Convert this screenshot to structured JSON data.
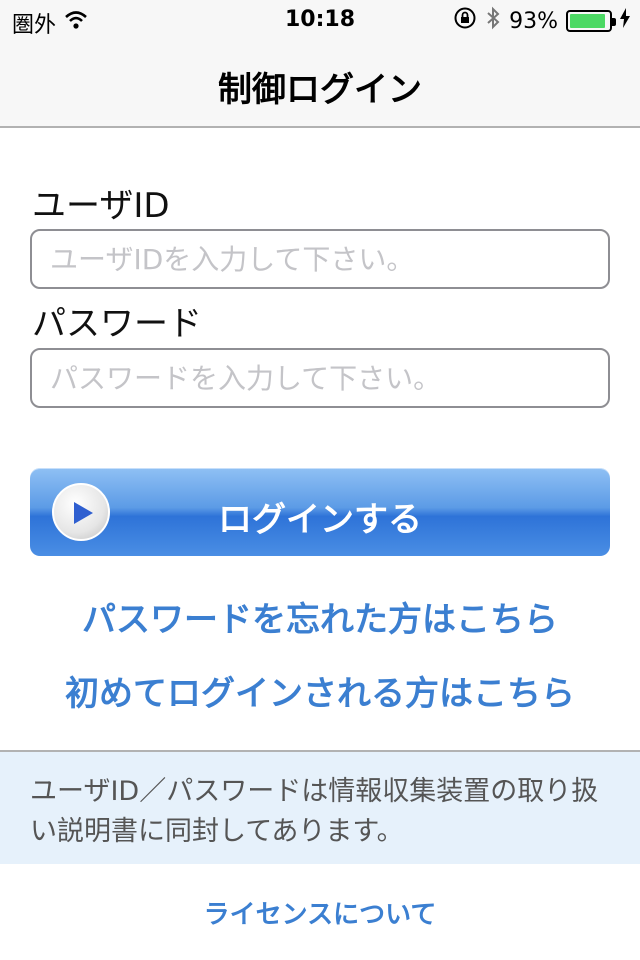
{
  "status_bar": {
    "carrier": "圏外",
    "time": "10:18",
    "battery_percent": "93%",
    "battery_level": 0.93,
    "icons": [
      "wifi-icon",
      "rotation-lock-icon",
      "bluetooth-icon",
      "battery-icon",
      "charging-bolt-icon"
    ]
  },
  "nav": {
    "title": "制御ログイン"
  },
  "form": {
    "user_id_label": "ユーザID",
    "user_id_placeholder": "ユーザIDを入力して下さい。",
    "user_id_value": "",
    "password_label": "パスワード",
    "password_placeholder": "パスワードを入力して下さい。",
    "password_value": "",
    "login_button": "ログインする",
    "login_button_icon": "play-icon"
  },
  "links": {
    "forgot_password": "パスワードを忘れた方はこちら",
    "first_login": "初めてログインされる方はこちら"
  },
  "info": {
    "text": "ユーザID／パスワードは情報収集装置の取り扱い説明書に同封してあります。"
  },
  "footer": {
    "license_link": "ライセンスについて"
  },
  "colors": {
    "accent": "#3b7fd1",
    "button_top": "#8fc0f4",
    "button_bottom": "#2e73d8",
    "info_bg": "#e6f1fb",
    "battery": "#4cd964"
  }
}
